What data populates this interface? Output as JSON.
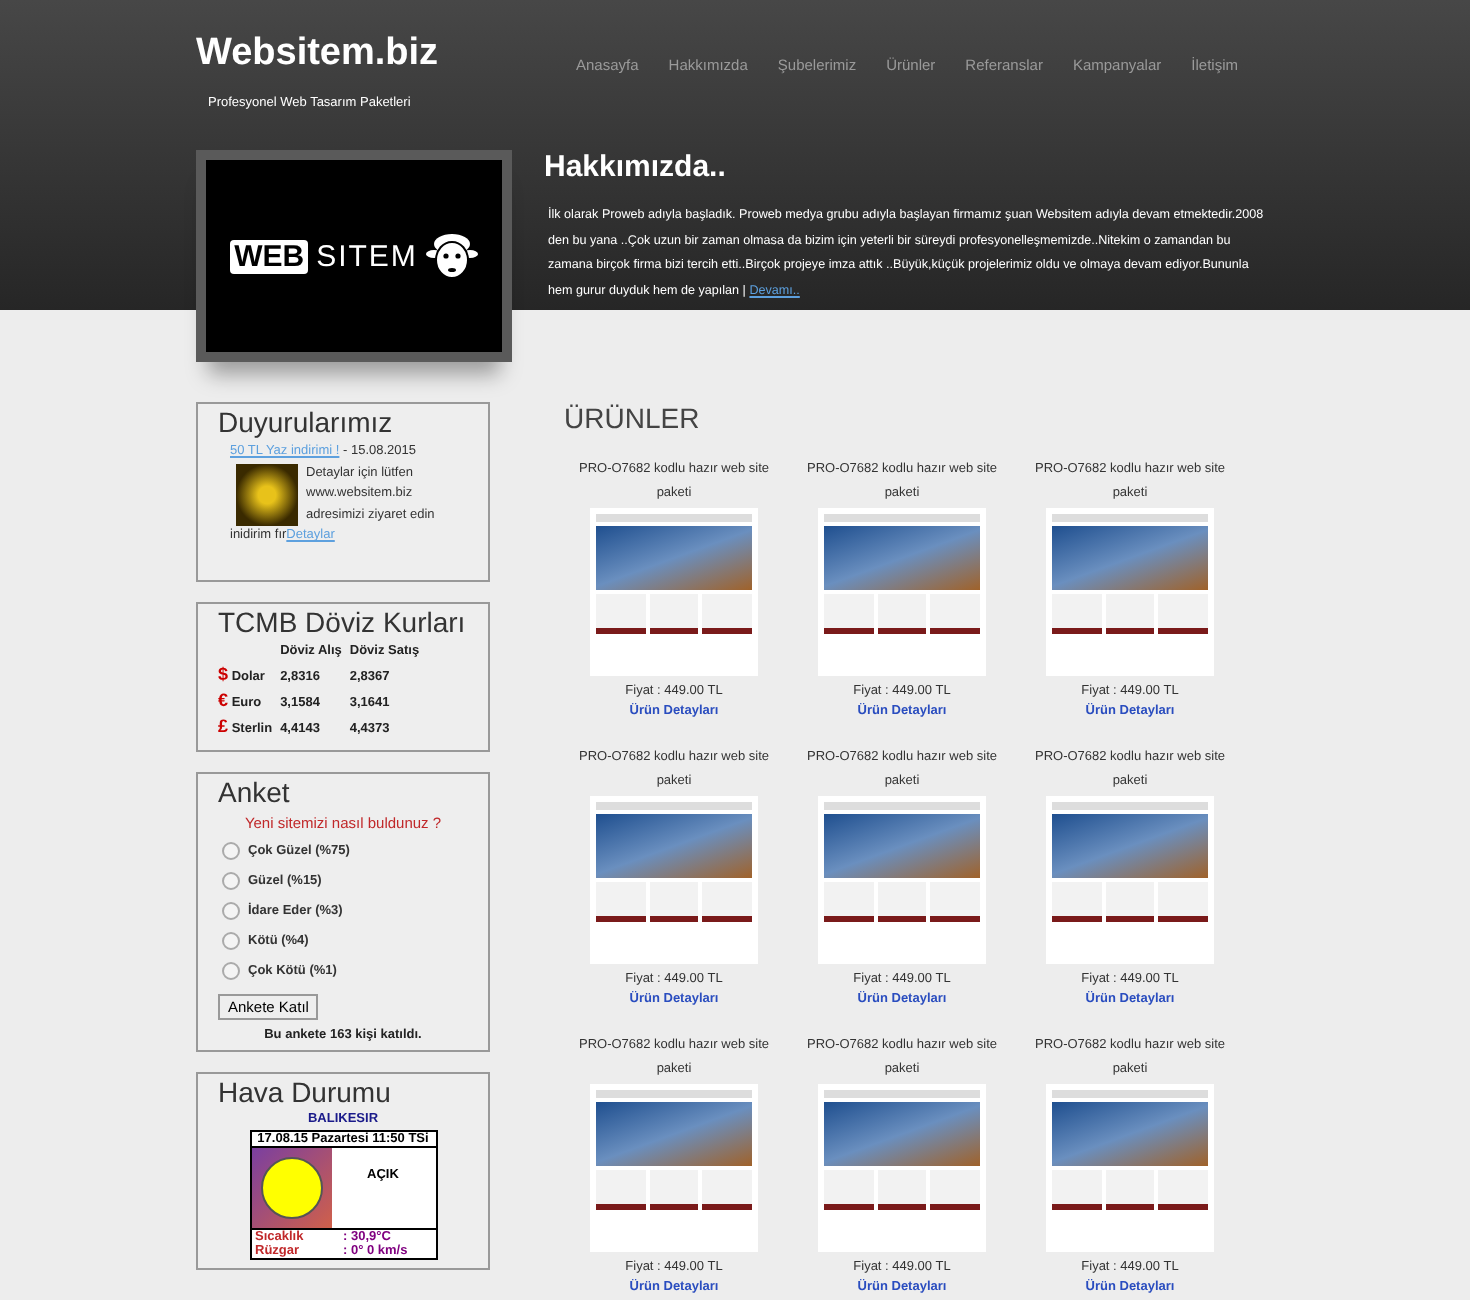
{
  "header": {
    "site_title": "Websitem.biz",
    "tagline": "Profesyonel Web Tasarım Paketleri",
    "nav": [
      {
        "label": "Anasayfa"
      },
      {
        "label": "Hakkımızda"
      },
      {
        "label": "Şubelerimiz"
      },
      {
        "label": "Ürünler"
      },
      {
        "label": "Referanslar"
      },
      {
        "label": "Kampanyalar"
      },
      {
        "label": "İletişim"
      }
    ]
  },
  "logo": {
    "boxed_word": "WEB",
    "word": "SITEM"
  },
  "about": {
    "title": "Hakkımızda..",
    "text": "İlk olarak Proweb adıyla başladık. Proweb medya grubu adıyla başlayan firmamız şuan Websitem adıyla devam etmektedir.2008 den bu yana ..Çok uzun bir zaman olmasa da bizim için yeterli bir süreydi profesyonelleşmemizde..Nitekim o zamandan bu zamana birçok firma bizi tercih etti..Birçok projeye imza attık ..Büyük,küçük projelerimiz oldu ve olmaya devam ediyor.Bununla hem gurur duyduk hem de yapılan |",
    "more_link": "Devamı.."
  },
  "announcements": {
    "title": "Duyurularımız",
    "items": [
      {
        "link": "50 TL Yaz indirimi !",
        "date": "- 15.08.2015",
        "text": "Detaylar için lütfen www.websitem.biz adresimizi ziyaret edin",
        "text_after": "inidirim fır",
        "details_link": "Detaylar"
      }
    ]
  },
  "currency": {
    "title": "TCMB Döviz Kurları",
    "columns": [
      "Döviz Alış",
      "Döviz Satış"
    ],
    "rows": [
      {
        "symbol": "$",
        "name": "Dolar",
        "buy": "2,8316",
        "sell": "2,8367"
      },
      {
        "symbol": "€",
        "name": "Euro",
        "buy": "3,1584",
        "sell": "3,1641"
      },
      {
        "symbol": "£",
        "name": "Sterlin",
        "buy": "4,4143",
        "sell": "4,4373"
      }
    ]
  },
  "poll": {
    "title": "Anket",
    "question": "Yeni sitemizi nasıl buldunuz ?",
    "options": [
      {
        "label": "Çok Güzel  (%75)",
        "selected": false
      },
      {
        "label": "Güzel  (%15)",
        "selected": false
      },
      {
        "label": "İdare Eder  (%3)",
        "selected": false
      },
      {
        "label": "Kötü  (%4)",
        "selected": false
      },
      {
        "label": "Çok Kötü  (%1)",
        "selected": false
      }
    ],
    "button": "Ankete Katıl",
    "footer": "Bu ankete 163 kişi katıldı."
  },
  "weather": {
    "title": "Hava Durumu",
    "city": "BALIKESIR",
    "datetime": "17.08.15 Pazartesi 11:50 TSi",
    "condition": "AÇIK",
    "rows": [
      {
        "label": "Sıcaklık",
        "value": ": 30,9°C"
      },
      {
        "label": "Rüzgar",
        "value": ": 0° 0 km/s"
      }
    ]
  },
  "products": {
    "title": "ÜRÜNLER",
    "items": [
      {
        "name": "PRO-O7682 kodlu hazır web site paketi",
        "price": "Fiyat : 449.00 TL",
        "link": "Ürün Detayları"
      },
      {
        "name": "PRO-O7682 kodlu hazır web site paketi",
        "price": "Fiyat : 449.00 TL",
        "link": "Ürün Detayları"
      },
      {
        "name": "PRO-O7682 kodlu hazır web site paketi",
        "price": "Fiyat : 449.00 TL",
        "link": "Ürün Detayları"
      },
      {
        "name": "PRO-O7682 kodlu hazır web site paketi",
        "price": "Fiyat : 449.00 TL",
        "link": "Ürün Detayları"
      },
      {
        "name": "PRO-O7682 kodlu hazır web site paketi",
        "price": "Fiyat : 449.00 TL",
        "link": "Ürün Detayları"
      },
      {
        "name": "PRO-O7682 kodlu hazır web site paketi",
        "price": "Fiyat : 449.00 TL",
        "link": "Ürün Detayları"
      },
      {
        "name": "PRO-O7682 kodlu hazır web site paketi",
        "price": "Fiyat : 449.00 TL",
        "link": "Ürün Detayları"
      },
      {
        "name": "PRO-O7682 kodlu hazır web site paketi",
        "price": "Fiyat : 449.00 TL",
        "link": "Ürün Detayları"
      },
      {
        "name": "PRO-O7682 kodlu hazır web site paketi",
        "price": "Fiyat : 449.00 TL",
        "link": "Ürün Detayları"
      }
    ]
  }
}
